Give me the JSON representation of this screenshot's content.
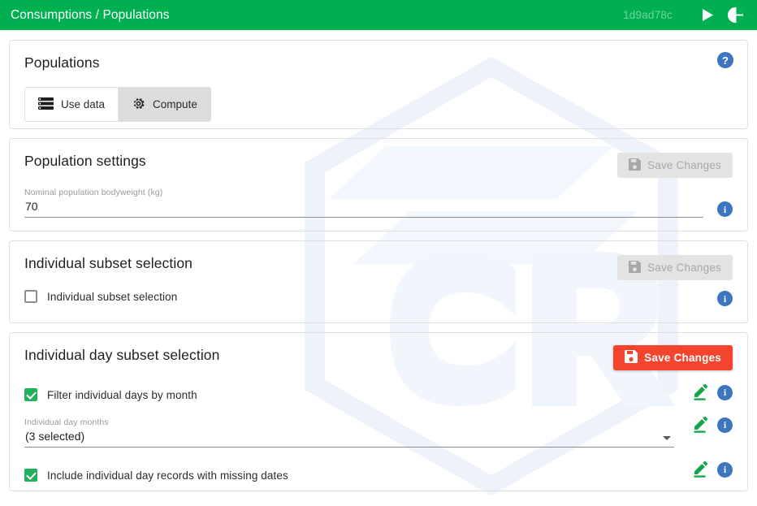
{
  "appbar": {
    "title": "Consumptions / Populations",
    "hash": "1d9ad78c",
    "run_icon": "play-icon",
    "contrast_icon": "contrast-icon",
    "background_color": "#00b050"
  },
  "cards": {
    "populations": {
      "title": "Populations",
      "help_icon": "help-icon",
      "help_label": "?",
      "toggle": {
        "use_data_label": "Use data",
        "use_data_icon": "storage-list-icon",
        "compute_label": "Compute",
        "compute_icon": "gear-icon",
        "selected": "Compute"
      }
    },
    "population_settings": {
      "title": "Population settings",
      "save_label": "Save Changes",
      "save_icon": "save-floppy-icon",
      "save_enabled": false,
      "field_label": "Nominal population bodyweight (kg)",
      "field_value": "70",
      "info_icon": "info-icon",
      "info_label": "i"
    },
    "individual_subset_selection": {
      "title": "Individual subset selection",
      "save_label": "Save Changes",
      "save_icon": "save-floppy-icon",
      "save_enabled": false,
      "checkbox_label": "Individual subset selection",
      "checkbox_checked": false,
      "info_icon": "info-icon",
      "info_label": "i"
    },
    "individual_day_subset_selection": {
      "title": "Individual day subset selection",
      "save_label": "Save Changes",
      "save_icon": "save-floppy-icon",
      "save_enabled": true,
      "save_color": "#f4442e",
      "filter_checkbox_label": "Filter individual days by month",
      "filter_checkbox_checked": true,
      "months_field_label": "Individual day months",
      "months_field_value": "(3 selected)",
      "missing_dates_checkbox_label": "Include individual day records with missing dates",
      "missing_dates_checkbox_checked": true,
      "edit_icon": "pencil-edit-icon",
      "info_icon": "info-icon",
      "info_label": "i"
    }
  },
  "colors": {
    "brand_green": "#00b050",
    "checkbox_green": "#20b25a",
    "danger_red": "#f4442e",
    "info_blue": "#3d76bf",
    "edit_green": "#15a84a"
  }
}
